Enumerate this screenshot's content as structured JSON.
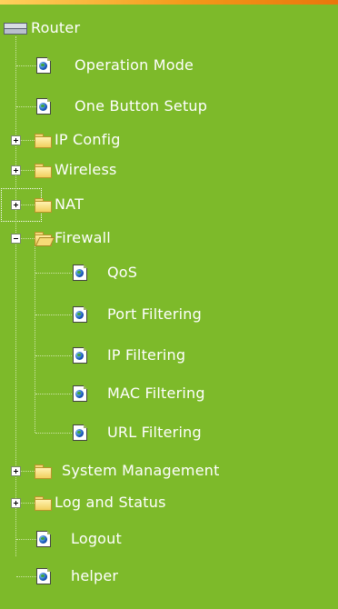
{
  "tree": {
    "root": "Router",
    "operation_mode": "Operation Mode",
    "one_button_setup": "One Button Setup",
    "ip_config": "IP Config",
    "wireless": "Wireless",
    "nat": "NAT",
    "firewall": "Firewall",
    "firewall_children": [
      "QoS",
      "Port Filtering",
      "IP Filtering",
      "MAC Filtering",
      "URL Filtering"
    ],
    "system_management": "System Management",
    "log_and_status": "Log and Status",
    "logout": "Logout",
    "helper": "helper"
  },
  "colors": {
    "background": "#7dba2a",
    "text": "#ffffff",
    "top_bar": "#f39a1a"
  },
  "icons": {
    "root": "router-icon",
    "page": "page-globe-icon",
    "folder": "folder-icon",
    "folder_open": "folder-open-icon",
    "expand": "plus-box-icon",
    "collapse": "minus-box-icon"
  }
}
